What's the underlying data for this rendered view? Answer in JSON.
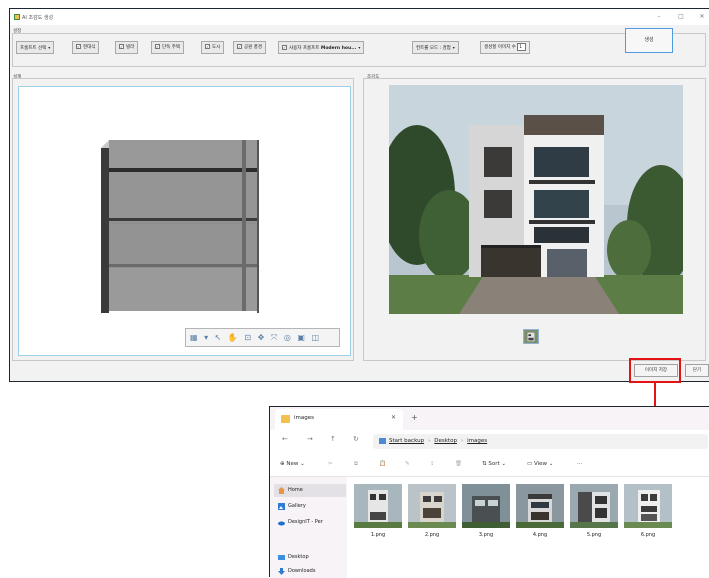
{
  "app": {
    "title": "AI 조감도 생성",
    "settings_label": "설정",
    "design_label": "설계",
    "render_label": "조감도",
    "prompt_select": "프롬프트 선택",
    "checks": [
      {
        "label": "현대식",
        "checked": true
      },
      {
        "label": "빌라",
        "checked": true
      },
      {
        "label": "단독 주택",
        "checked": true
      },
      {
        "label": "도시",
        "checked": true
      },
      {
        "label": "공원 풍경",
        "checked": true
      },
      {
        "label": "사용자 프롬프트",
        "checked": true,
        "value": "Modern hou..."
      }
    ],
    "control_mode": "컨트롤 모드 : 경험",
    "image_count_label": "생성할 이미지 수",
    "image_count": "1",
    "generate_button": "생성",
    "save_image_button": "이미지 저장",
    "close_button": "닫기",
    "check_mark": "✓",
    "dropdown_arrow": "▾",
    "min_glyph": "–",
    "max_glyph": "□",
    "close_glyph": "✕"
  },
  "viewport_toolbar": {
    "glyphs": "▦ ▾ ↖ ✋ ⊡ ✥ ⤧ ◎ ▣ ◫"
  },
  "explorer": {
    "tab_title": "images",
    "tab_close": "✕",
    "new_tab": "+",
    "nav": {
      "back": "←",
      "forward": "→",
      "up": "↑",
      "refresh": "↻"
    },
    "breadcrumb": [
      "Start backup",
      "Desktop",
      "images"
    ],
    "breadcrumb_sep": "›",
    "toolbar": {
      "new": "New",
      "cut": "✂",
      "copy": "⧉",
      "paste": "📋",
      "rename": "✎",
      "share": "⇪",
      "delete": "🗑",
      "sort": "Sort",
      "view": "View",
      "more": "···"
    },
    "sidebar": [
      {
        "label": "Home",
        "icon": "home-icon",
        "active": true
      },
      {
        "label": "Gallery",
        "icon": "gallery-icon",
        "active": false
      },
      {
        "label": "DesignIT - Per",
        "icon": "cloud-icon",
        "active": false
      },
      {
        "label": "Desktop",
        "icon": "desktop-icon",
        "active": false
      },
      {
        "label": "Downloads",
        "icon": "downloads-icon",
        "active": false
      }
    ],
    "files": [
      "1.png",
      "2.png",
      "3.png",
      "4.png",
      "5.png",
      "6.png"
    ]
  },
  "colors": {
    "accent_blue": "#4f9ae0",
    "highlight_red": "#e31313",
    "window_border": "#1d2533"
  }
}
